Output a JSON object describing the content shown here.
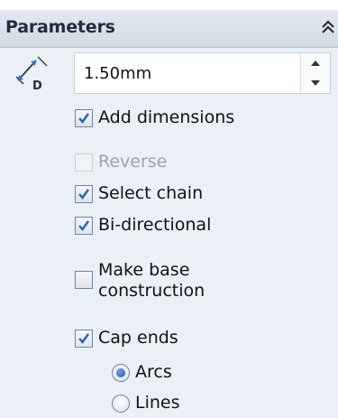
{
  "panel": {
    "title": "Parameters"
  },
  "distance": {
    "value": "1.50mm",
    "icon_letter": "D"
  },
  "options": {
    "add_dimensions": {
      "label": "Add dimensions",
      "checked": true
    },
    "reverse": {
      "label": "Reverse",
      "checked": false,
      "disabled": true
    },
    "select_chain": {
      "label": "Select chain",
      "checked": true
    },
    "bi_directional": {
      "label": "Bi-directional",
      "checked": true
    },
    "make_base_construction": {
      "label_line1": "Make base",
      "label_line2": "construction",
      "checked": false
    },
    "cap_ends": {
      "label": "Cap ends",
      "checked": true
    }
  },
  "cap_type": {
    "arcs": {
      "label": "Arcs",
      "selected": true
    },
    "lines": {
      "label": "Lines",
      "selected": false
    }
  },
  "colors": {
    "header_text": "#1e2d3f",
    "body_background": "#eaf0f6",
    "check_blue": "#2b5fb8"
  }
}
